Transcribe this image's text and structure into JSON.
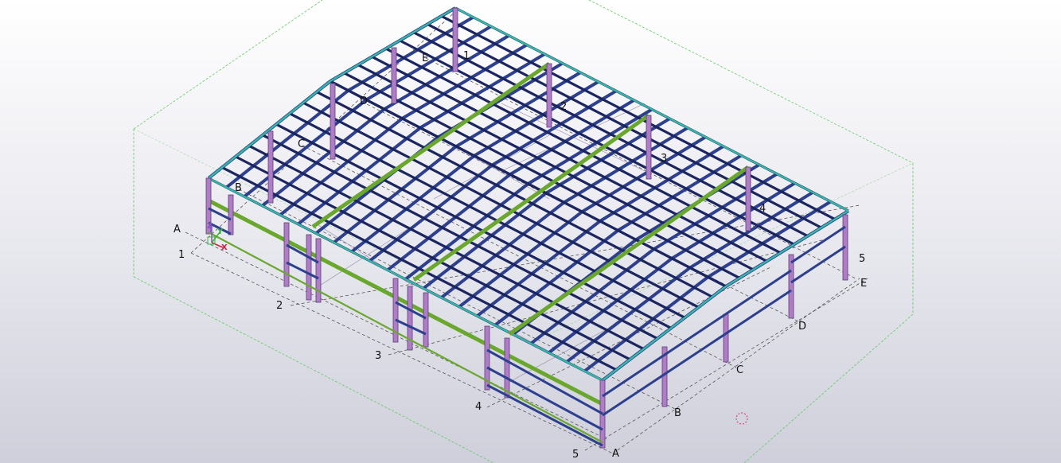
{
  "viewport": {
    "colors": {
      "background_top": "#ffffff",
      "background_bottom": "#cfcfdb",
      "work_area_box": "#5fcc5f",
      "column_purple": "#b07cc8",
      "column_edge": "#5a3f73",
      "purlin_blue": "#2d3f8f",
      "purlin_edge": "#1b2660",
      "ridge_green": "#6aa82d",
      "eave_teal": "#36b6a6",
      "bracing_grey": "#9a8faf",
      "grid_line": "#555555",
      "origin_marker": "#e04080"
    },
    "grid_labels": {
      "near_numbers": [
        "1",
        "2",
        "3",
        "4",
        "5"
      ],
      "near_letters": [
        "A",
        "B",
        "C",
        "D",
        "E"
      ],
      "far_numbers": [
        "1",
        "2",
        "3",
        "4",
        "5"
      ],
      "far_letters": [
        "B",
        "C",
        "D",
        "E"
      ],
      "origin_letter": "A"
    },
    "coordinate_axes": {
      "x_label": "X",
      "y_label": "Y",
      "z_label": "Z"
    },
    "icons": [
      "coordinate-axes-icon",
      "origin-marker-icon"
    ]
  }
}
